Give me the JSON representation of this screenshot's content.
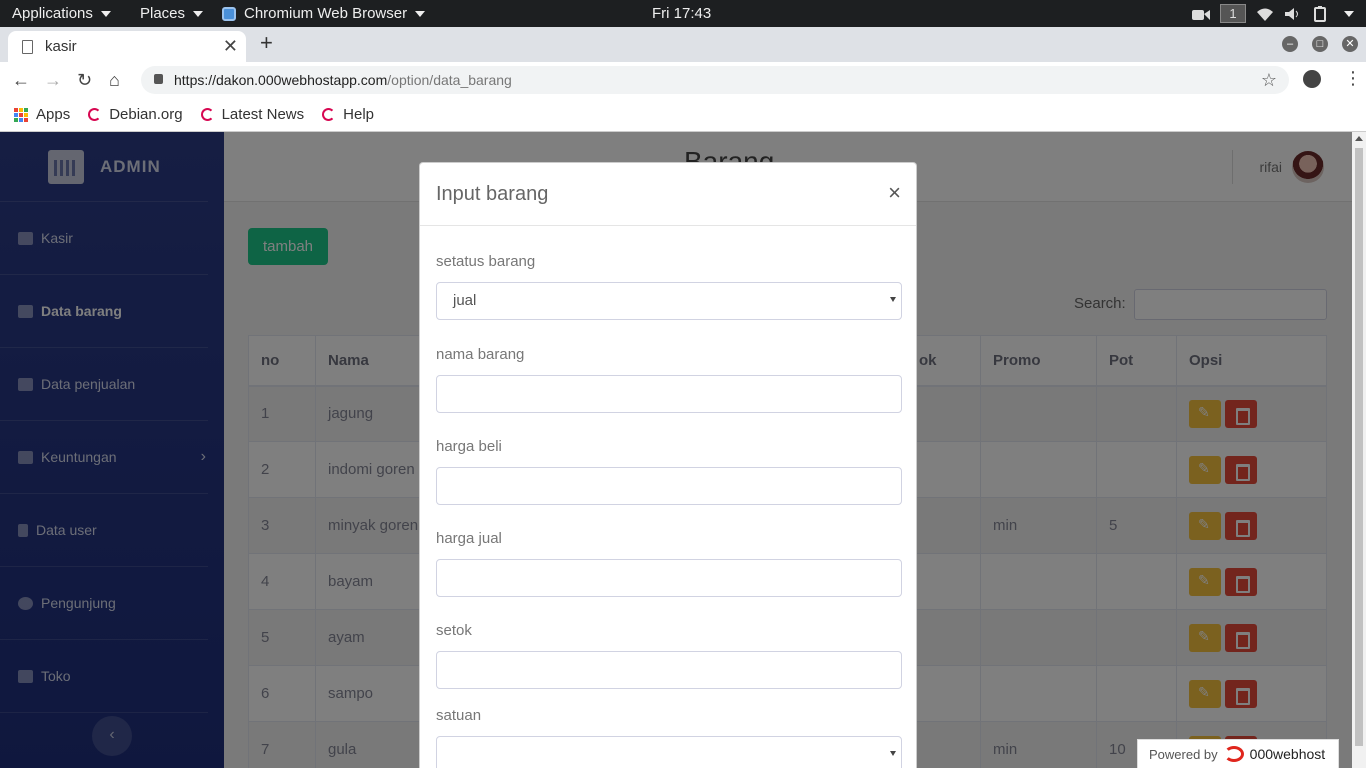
{
  "system_bar": {
    "applications": "Applications",
    "places": "Places",
    "active_app": "Chromium Web Browser",
    "clock": "Fri 17:43",
    "workspace": "1"
  },
  "browser": {
    "tab_title": "kasir",
    "url_host": "https://dakon.000webhostapp.com",
    "url_path": "/option/data_barang",
    "bookmarks": [
      "Apps",
      "Debian.org",
      "Latest News",
      "Help"
    ]
  },
  "sidebar": {
    "brand": "ADMIN",
    "items": [
      {
        "label": "Kasir"
      },
      {
        "label": "Data barang"
      },
      {
        "label": "Data penjualan"
      },
      {
        "label": "Keuntungan"
      },
      {
        "label": "Data user"
      },
      {
        "label": "Pengunjung"
      },
      {
        "label": "Toko"
      }
    ],
    "collapse_glyph": "‹"
  },
  "header": {
    "title": "Barang",
    "user": "rifai"
  },
  "content": {
    "add_button": "tambah",
    "search_label": "Search:",
    "columns": [
      "no",
      "Nama",
      "ok",
      "Promo",
      "Pot",
      "Opsi"
    ],
    "rows": [
      {
        "no": "1",
        "nama": "jagung",
        "promo": "",
        "pot": ""
      },
      {
        "no": "2",
        "nama": "indomi goren",
        "promo": "",
        "pot": ""
      },
      {
        "no": "3",
        "nama": "minyak goren",
        "promo": "min",
        "pot": "5"
      },
      {
        "no": "4",
        "nama": "bayam",
        "promo": "",
        "pot": ""
      },
      {
        "no": "5",
        "nama": "ayam",
        "promo": "",
        "pot": ""
      },
      {
        "no": "6",
        "nama": "sampo",
        "promo": "",
        "pot": ""
      },
      {
        "no": "7",
        "nama": "gula",
        "promo": "min",
        "pot": "10"
      }
    ]
  },
  "modal": {
    "title": "Input barang",
    "close": "×",
    "fields": {
      "status_label": "setatus barang",
      "status_value": "jual",
      "nama_label": "nama barang",
      "harga_beli_label": "harga beli",
      "harga_jual_label": "harga jual",
      "setok_label": "setok",
      "satuan_label": "satuan"
    }
  },
  "footer_badge": {
    "powered": "Powered by",
    "brand": "000webhost"
  }
}
